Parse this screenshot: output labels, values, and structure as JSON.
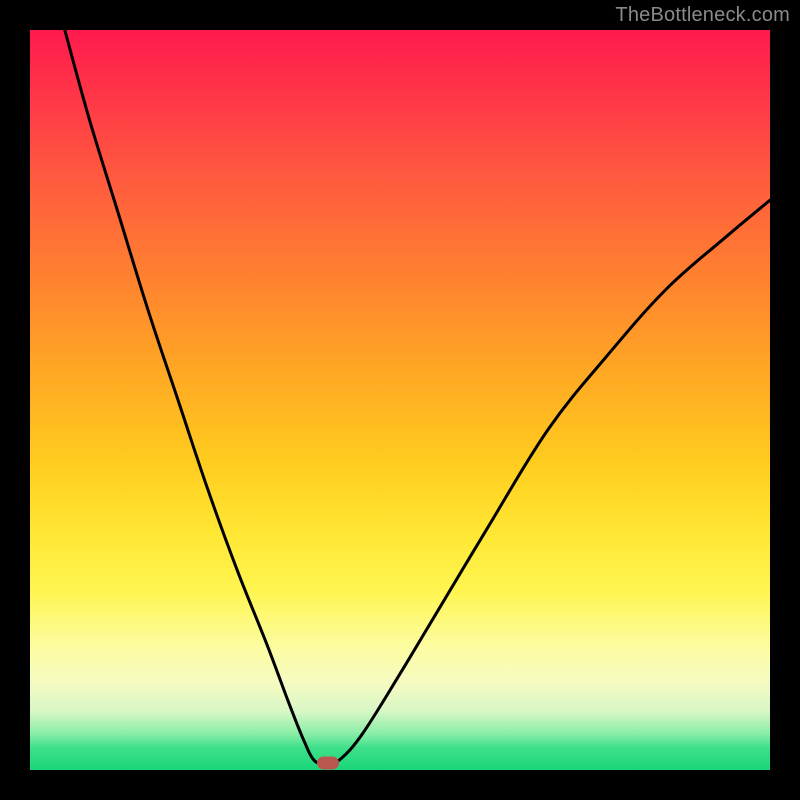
{
  "watermark": "TheBottleneck.com",
  "chart_data": {
    "type": "line",
    "title": "",
    "xlabel": "",
    "ylabel": "",
    "xlim": [
      0,
      100
    ],
    "ylim": [
      0,
      100
    ],
    "grid": false,
    "colors": {
      "curve": "#000000",
      "marker": "#b9564f",
      "gradient_top": "#ff1a4d",
      "gradient_bottom": "#1ad67a"
    },
    "annotations": {
      "minimum_marker": {
        "x": 40.3,
        "y": 0.9
      }
    },
    "series": [
      {
        "name": "left-branch",
        "x": [
          4.7,
          8,
          12,
          16,
          20,
          24,
          28,
          32,
          35,
          37,
          38.5,
          40.3
        ],
        "y": [
          100,
          88,
          75,
          62,
          50,
          38,
          27,
          17,
          9,
          4,
          1.2,
          0.9
        ]
      },
      {
        "name": "right-branch",
        "x": [
          40.3,
          42,
          45,
          50,
          56,
          62,
          70,
          78,
          86,
          94,
          100
        ],
        "y": [
          0.9,
          1.5,
          5,
          13,
          23,
          33,
          46,
          56,
          65,
          72,
          77
        ]
      }
    ]
  }
}
